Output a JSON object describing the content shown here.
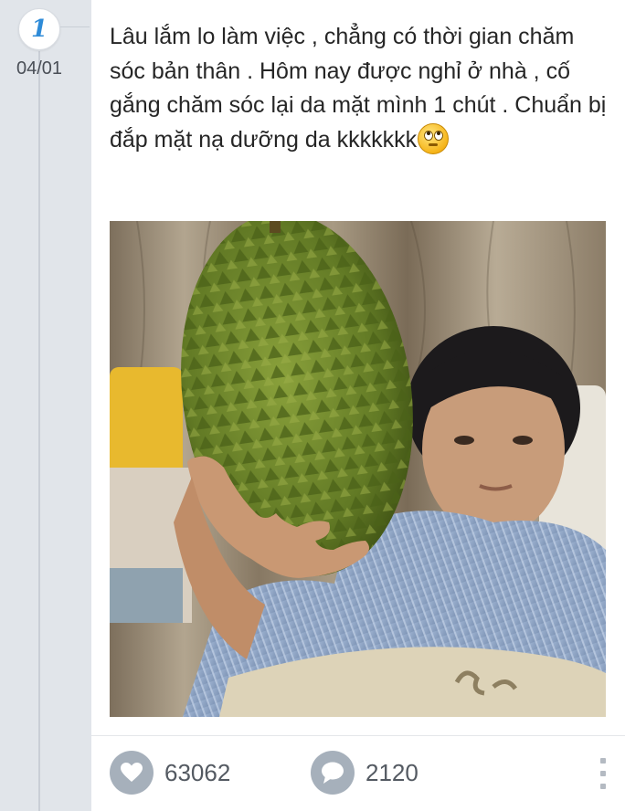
{
  "timeline": {
    "day_badge": "1",
    "date": "04/01"
  },
  "post": {
    "text": "Lâu lắm lo làm việc , chẳng có thời gian chăm sóc bản thân . Hôm nay được nghỉ ở nhà , cố gắng chăm sóc lại da mặt mình 1 chút . Chuẩn bị đắp mặt nạ dưỡng da kkkkkkk",
    "emoji": "rolling-eyes-emoji",
    "photo": "man-holding-durian-photo"
  },
  "actions": {
    "likes": "63062",
    "comments": "2120",
    "like_icon": "heart-icon",
    "comment_icon": "speech-bubble-icon",
    "more_icon": "more-vertical-icon"
  },
  "colors": {
    "background": "#e1e5ea",
    "card": "#ffffff",
    "accent": "#2e8bd8",
    "icon_bg": "#a6b0bb",
    "text": "#262626",
    "count_text": "#545a62"
  }
}
